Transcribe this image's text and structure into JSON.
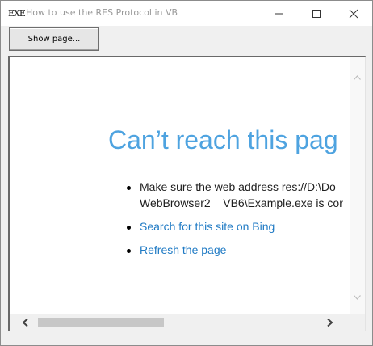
{
  "window": {
    "title": "How to use the RES Protocol in VB",
    "app_icon_text": "EXE",
    "controls": {
      "minimize_icon": "minimize-icon",
      "maximize_icon": "maximize-icon",
      "close_icon": "close-icon"
    }
  },
  "toolbar": {
    "show_page_label": "Show page..."
  },
  "browser": {
    "error_heading": "Can’t reach this pag",
    "bullets": [
      {
        "line1": "Make sure the web address res://D:\\Do",
        "line2": "WebBrowser2__VB6\\Example.exe is cor"
      },
      {
        "link": "Search for this site on Bing"
      },
      {
        "link": "Refresh the page"
      }
    ],
    "colors": {
      "heading": "#4ea3e0",
      "link": "#1f7ac4"
    }
  },
  "scrollbars": {
    "vertical": {
      "up_icon": "scroll-up-icon",
      "down_icon": "scroll-down-icon"
    },
    "horizontal": {
      "left_icon": "scroll-left-icon",
      "right_icon": "scroll-right-icon"
    }
  }
}
